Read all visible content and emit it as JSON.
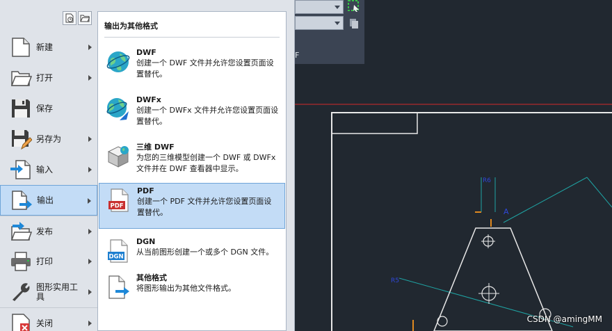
{
  "colors": {
    "accent": "#c3dcf6",
    "accent_border": "#6ea4d8",
    "canvas_bg": "#212830",
    "red_line": "#e02020",
    "cyan_line": "#1fa3a3"
  },
  "left_menu": [
    {
      "label": "新建",
      "icon": "new-document-icon",
      "arrow": true
    },
    {
      "label": "打开",
      "icon": "open-folder-icon",
      "arrow": true
    },
    {
      "label": "保存",
      "icon": "save-disk-icon",
      "arrow": false
    },
    {
      "label": "另存为",
      "icon": "save-as-icon",
      "arrow": true
    },
    {
      "label": "输入",
      "icon": "import-icon",
      "arrow": true
    },
    {
      "label": "输出",
      "icon": "export-icon",
      "arrow": true,
      "selected": true
    },
    {
      "label": "发布",
      "icon": "publish-icon",
      "arrow": true
    },
    {
      "label": "打印",
      "icon": "printer-icon",
      "arrow": true
    },
    {
      "label": "图形实用工具",
      "icon": "wrench-icon",
      "arrow": true
    },
    {
      "label": "关闭",
      "icon": "close-document-icon",
      "arrow": true
    }
  ],
  "submenu": {
    "title": "输出为其他格式",
    "options": [
      {
        "name": "DWF",
        "desc": "创建一个 DWF 文件并允许您设置页面设置替代。",
        "icon": "dwf-globe-icon"
      },
      {
        "name": "DWFx",
        "desc": "创建一个 DWFx 文件并允许您设置页面设置替代。",
        "icon": "dwfx-globe-icon"
      },
      {
        "name": "三维 DWF",
        "desc": "为您的三维模型创建一个 DWF 或 DWFx 文件并在 DWF 查看器中显示。",
        "icon": "3d-dwf-cube-icon"
      },
      {
        "name": "PDF",
        "desc": "创建一个 PDF 文件并允许您设置页面设置替代。",
        "icon": "pdf-file-icon",
        "selected": true
      },
      {
        "name": "DGN",
        "desc": "从当前图形创建一个或多个 DGN 文件。",
        "icon": "dgn-file-icon"
      },
      {
        "name": "其他格式",
        "desc": "将图形输出为其他文件格式。",
        "icon": "export-other-icon"
      }
    ]
  },
  "ribbon": {
    "tail_text": "F"
  },
  "watermark": "CSDN @amingMM"
}
